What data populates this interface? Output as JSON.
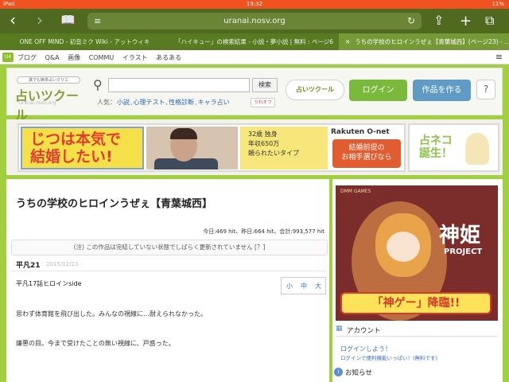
{
  "status_bar": {
    "device": "iPad",
    "time": "19:32",
    "battery": "11%"
  },
  "browser": {
    "url": "uranai.nosv.org",
    "tabs": [
      {
        "label": "ONE OFF MIND - 初音ミク Wiki - アットウィキ"
      },
      {
        "label": "「ハイキュー」の検索結果 - 小説・夢小説 | 無料 : ページ6"
      },
      {
        "label": "うちの学校のヒロインうぜぇ【青葉城西】(ページ23) - ..."
      }
    ]
  },
  "site_nav": {
    "logo": "U4",
    "links": [
      "ブログ",
      "Q&A",
      "画像",
      "COMMU",
      "イラスト",
      "あるある"
    ]
  },
  "header": {
    "logo_tagline": "誰でも簡単占いクリエ",
    "logo_main": "占いツクール",
    "logo_sub": "uranai.nosv.org",
    "search_button": "検索",
    "popular_label": "人気：",
    "popular_links": [
      "小説",
      "心理テスト",
      "性格診断",
      "キャラ占い"
    ],
    "rss_label": "りれオフ",
    "tsukuru_label": "占いツクール",
    "login_button": "ログイン",
    "create_button": "作品を作る",
    "help_button": "?"
  },
  "banners": {
    "main_text_line1": "じつは本気で",
    "main_text_line2": "結婚したい!",
    "profile_line1": "32歳 独身",
    "profile_line2": "年収650万",
    "profile_line3": "頼られたいタイプ",
    "rakuten": "Rakuten O-net",
    "rakuten_box_line1": "結婚前提の",
    "rakuten_box_line2": "お相手選びなら",
    "neko_line1": "占ネコ",
    "neko_line2": "誕生！"
  },
  "story": {
    "title": "うちの学校のヒロインうぜぇ【青葉城西】",
    "hits": "今日:469 hit、昨日:664 hit、合計:993,577 hit",
    "notice": "(注) この作品は完結していない状態でしばらく更新されていません [？]",
    "author": "平凡21",
    "date": "2015/12/23",
    "chapter_title": "平凡17話ヒロインside",
    "font_small": "小",
    "font_medium": "中",
    "font_large": "大",
    "paragraphs": [
      "思わず体育館を飛び出した。みんなの視線に…耐えられなかった。",
      "嫌悪の目。今まで受けたことの無い視線に、戸惑った。"
    ]
  },
  "sidebar": {
    "ad_brand": "DMM GAMES",
    "ad_title": "神姫",
    "ad_project": "PROJECT",
    "ad_slogan": "「神ゲー」降臨!!",
    "account_title": "アカウント",
    "login_link": "ログインしよう！",
    "login_note": "ログインで便利機能いっぱい！(無料です)",
    "info_title": "お知らせ"
  }
}
